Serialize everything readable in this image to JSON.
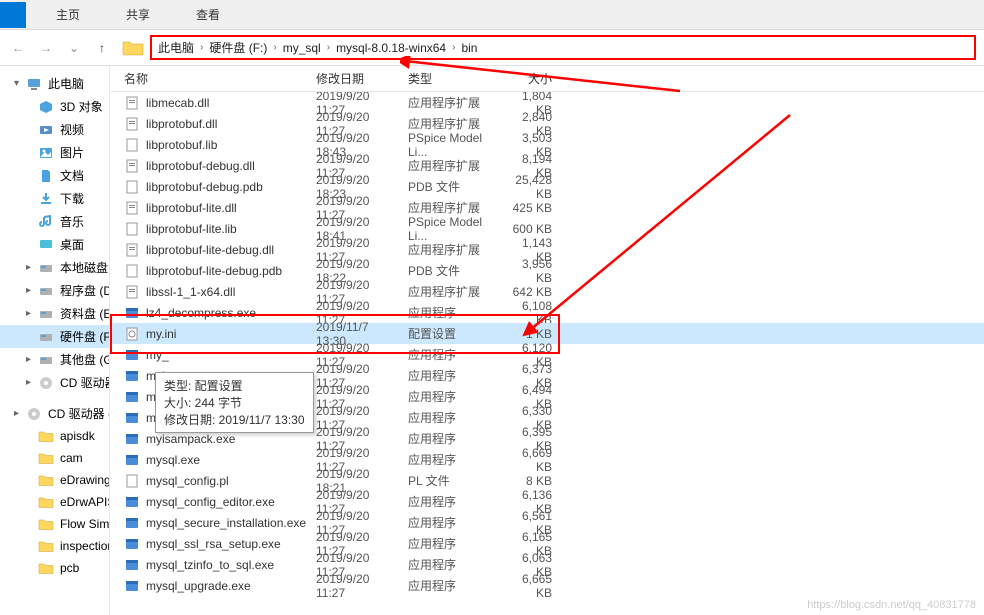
{
  "toolbar": {
    "tab_home": "主页",
    "tab_share": "共享",
    "tab_view": "查看"
  },
  "breadcrumb": {
    "items": [
      "此电脑",
      "硬件盘 (F:)",
      "my_sql",
      "mysql-8.0.18-winx64",
      "bin"
    ]
  },
  "sidebar": {
    "items": [
      {
        "label": "此电脑",
        "icon": "pc",
        "expand": "▾"
      },
      {
        "label": "3D 对象",
        "icon": "3d",
        "indent": true
      },
      {
        "label": "视频",
        "icon": "video",
        "indent": true
      },
      {
        "label": "图片",
        "icon": "pic",
        "indent": true
      },
      {
        "label": "文档",
        "icon": "docs",
        "indent": true
      },
      {
        "label": "下载",
        "icon": "dl",
        "indent": true
      },
      {
        "label": "音乐",
        "icon": "music",
        "indent": true
      },
      {
        "label": "桌面",
        "icon": "desk",
        "indent": true
      },
      {
        "label": "本地磁盘 (C:)",
        "icon": "disk",
        "indent": true,
        "expand": "▸"
      },
      {
        "label": "程序盘 (D:)",
        "icon": "disk",
        "indent": true,
        "expand": "▸"
      },
      {
        "label": "资料盘 (E:)",
        "icon": "disk",
        "indent": true,
        "expand": "▸"
      },
      {
        "label": "硬件盘 (F:)",
        "icon": "disk",
        "indent": true,
        "sel": true
      },
      {
        "label": "其他盘 (G:)",
        "icon": "disk",
        "indent": true,
        "expand": "▸"
      },
      {
        "label": "CD 驱动器 (V:)",
        "icon": "cd",
        "indent": true,
        "expand": "▸"
      },
      {
        "label": "",
        "icon": "",
        "gap": true
      },
      {
        "label": "CD 驱动器 (V:) So",
        "icon": "cd",
        "expand": "▸"
      },
      {
        "label": "apisdk",
        "icon": "folder",
        "indent": true
      },
      {
        "label": "cam",
        "icon": "folder",
        "indent": true
      },
      {
        "label": "eDrawings",
        "icon": "folder",
        "indent": true
      },
      {
        "label": "eDrwAPISDK",
        "icon": "folder",
        "indent": true
      },
      {
        "label": "Flow Simulation",
        "icon": "folder",
        "indent": true
      },
      {
        "label": "inspection",
        "icon": "folder",
        "indent": true
      },
      {
        "label": "pcb",
        "icon": "folder",
        "indent": true
      }
    ]
  },
  "columns": {
    "name": "名称",
    "date": "修改日期",
    "type": "类型",
    "size": "大小"
  },
  "files": [
    {
      "name": "libmecab.dll",
      "date": "2019/9/20 11:27",
      "type": "应用程序扩展",
      "size": "1,804 KB",
      "icon": "dll"
    },
    {
      "name": "libprotobuf.dll",
      "date": "2019/9/20 11:27",
      "type": "应用程序扩展",
      "size": "2,840 KB",
      "icon": "dll"
    },
    {
      "name": "libprotobuf.lib",
      "date": "2019/9/20 18:43",
      "type": "PSpice Model Li...",
      "size": "3,503 KB",
      "icon": "lib"
    },
    {
      "name": "libprotobuf-debug.dll",
      "date": "2019/9/20 11:27",
      "type": "应用程序扩展",
      "size": "8,194 KB",
      "icon": "dll"
    },
    {
      "name": "libprotobuf-debug.pdb",
      "date": "2019/9/20 18:23",
      "type": "PDB 文件",
      "size": "25,428 KB",
      "icon": "pdb"
    },
    {
      "name": "libprotobuf-lite.dll",
      "date": "2019/9/20 11:27",
      "type": "应用程序扩展",
      "size": "425 KB",
      "icon": "dll"
    },
    {
      "name": "libprotobuf-lite.lib",
      "date": "2019/9/20 18:41",
      "type": "PSpice Model Li...",
      "size": "600 KB",
      "icon": "lib"
    },
    {
      "name": "libprotobuf-lite-debug.dll",
      "date": "2019/9/20 11:27",
      "type": "应用程序扩展",
      "size": "1,143 KB",
      "icon": "dll"
    },
    {
      "name": "libprotobuf-lite-debug.pdb",
      "date": "2019/9/20 18:22",
      "type": "PDB 文件",
      "size": "3,956 KB",
      "icon": "pdb"
    },
    {
      "name": "libssl-1_1-x64.dll",
      "date": "2019/9/20 11:27",
      "type": "应用程序扩展",
      "size": "642 KB",
      "icon": "dll"
    },
    {
      "name": "lz4_decompress.exe",
      "date": "2019/9/20 11:27",
      "type": "应用程序",
      "size": "6,108 KB",
      "icon": "exe"
    },
    {
      "name": "my.ini",
      "date": "2019/11/7 13:30",
      "type": "配置设置",
      "size": "1 KB",
      "icon": "ini",
      "sel": true
    },
    {
      "name": "my_",
      "date": "2019/9/20 11:27",
      "type": "应用程序",
      "size": "6,120 KB",
      "icon": "exe"
    },
    {
      "name": "myis",
      "date": "2019/9/20 11:27",
      "type": "应用程序",
      "size": "6,373 KB",
      "icon": "exe"
    },
    {
      "name": "myis",
      "date": "2019/9/20 11:27",
      "type": "应用程序",
      "size": "6,494 KB",
      "icon": "exe"
    },
    {
      "name": "myisamlog.exe",
      "date": "2019/9/20 11:27",
      "type": "应用程序",
      "size": "6,330 KB",
      "icon": "exe"
    },
    {
      "name": "myisampack.exe",
      "date": "2019/9/20 11:27",
      "type": "应用程序",
      "size": "6,395 KB",
      "icon": "exe"
    },
    {
      "name": "mysql.exe",
      "date": "2019/9/20 11:27",
      "type": "应用程序",
      "size": "6,669 KB",
      "icon": "exe"
    },
    {
      "name": "mysql_config.pl",
      "date": "2019/9/20 18:21",
      "type": "PL 文件",
      "size": "8 KB",
      "icon": "pl"
    },
    {
      "name": "mysql_config_editor.exe",
      "date": "2019/9/20 11:27",
      "type": "应用程序",
      "size": "6,136 KB",
      "icon": "exe"
    },
    {
      "name": "mysql_secure_installation.exe",
      "date": "2019/9/20 11:27",
      "type": "应用程序",
      "size": "6,561 KB",
      "icon": "exe"
    },
    {
      "name": "mysql_ssl_rsa_setup.exe",
      "date": "2019/9/20 11:27",
      "type": "应用程序",
      "size": "6,165 KB",
      "icon": "exe"
    },
    {
      "name": "mysql_tzinfo_to_sql.exe",
      "date": "2019/9/20 11:27",
      "type": "应用程序",
      "size": "6,063 KB",
      "icon": "exe"
    },
    {
      "name": "mysql_upgrade.exe",
      "date": "2019/9/20 11:27",
      "type": "应用程序",
      "size": "6,665 KB",
      "icon": "exe"
    }
  ],
  "tooltip": {
    "line1": "类型: 配置设置",
    "line2": "大小: 244 字节",
    "line3": "修改日期: 2019/11/7 13:30"
  },
  "watermark": "https://blog.csdn.net/qq_40831778"
}
